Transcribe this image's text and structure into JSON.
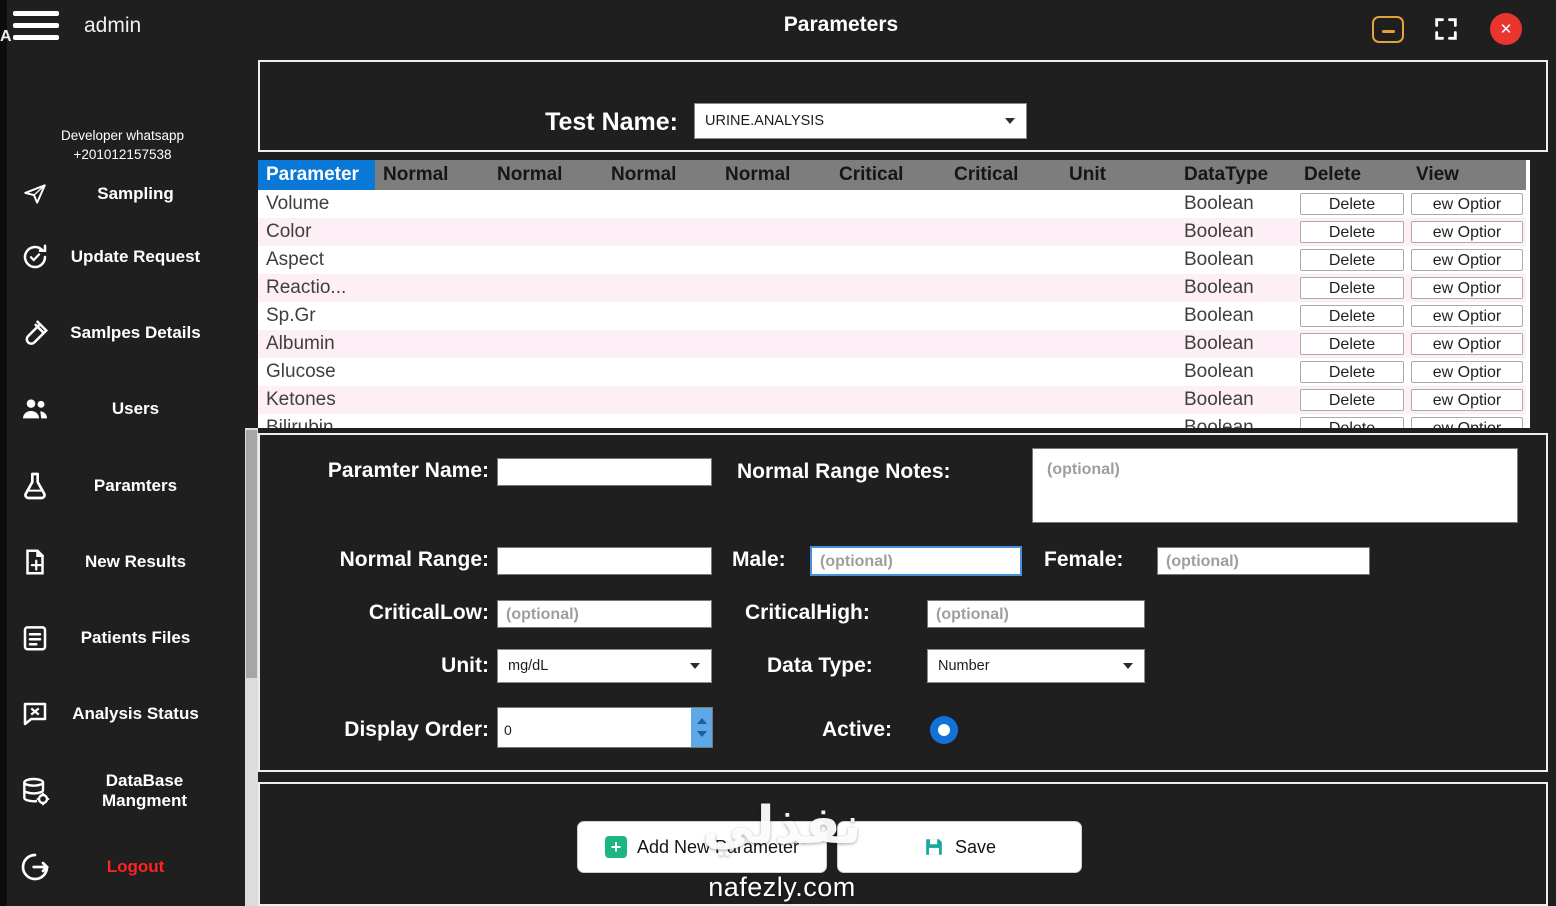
{
  "titlebar": {
    "user": "admin",
    "title": "Parameters"
  },
  "window": {
    "edge_letter": "A"
  },
  "icons": {
    "close": "✕",
    "plus": "+"
  },
  "colors": {
    "background": "#1f1f1f",
    "header_gray": "#7d7d7d",
    "selected_header_blue": "#0a78d7",
    "row_pink": "#fdeff5",
    "close_red": "#e8352e",
    "minimize_orange": "#e3a23c",
    "active_radio_blue": "#1173d8",
    "spinner_blue": "#5fa8e8",
    "add_icon_green": "#1db584",
    "save_icon_teal": "#16a89b",
    "logout_red": "#ff2222"
  },
  "sidebar": {
    "developer_line1": "Developer whatsapp",
    "developer_line2": "+201012157538",
    "items": [
      {
        "label": "Sampling",
        "icon": "paper-plane-icon"
      },
      {
        "label": "Update Request",
        "icon": "refresh-icon"
      },
      {
        "label": "Samlpes Details",
        "icon": "test-tube-icon"
      },
      {
        "label": "Users",
        "icon": "users-icon"
      },
      {
        "label": "Paramters",
        "icon": "flask-icon"
      },
      {
        "label": "New Results",
        "icon": "new-document-icon"
      },
      {
        "label": "Patients Files",
        "icon": "patient-file-icon"
      },
      {
        "label": "Analysis Status",
        "icon": "analysis-chat-icon"
      },
      {
        "label": "DataBase Mangment",
        "icon": "database-gear-icon"
      },
      {
        "label": "Logout",
        "icon": "logout-icon"
      }
    ]
  },
  "test_name": {
    "label": "Test Name:",
    "value": "URINE.ANALYSIS"
  },
  "table": {
    "headers": [
      "Parameter",
      "Normal",
      "Normal",
      "Normal",
      "Normal",
      "Critical",
      "Critical",
      "Unit",
      "DataType",
      "Delete",
      "View"
    ],
    "delete_label": "Delete",
    "view_label": "ew Optior",
    "rows": [
      {
        "parameter": "Volume",
        "datatype": "Boolean"
      },
      {
        "parameter": "Color",
        "datatype": "Boolean"
      },
      {
        "parameter": "Aspect",
        "datatype": "Boolean"
      },
      {
        "parameter": "Reactio...",
        "datatype": "Boolean"
      },
      {
        "parameter": "Sp.Gr",
        "datatype": "Boolean"
      },
      {
        "parameter": "Albumin",
        "datatype": "Boolean"
      },
      {
        "parameter": "Glucose",
        "datatype": "Boolean"
      },
      {
        "parameter": "Ketones",
        "datatype": "Boolean"
      },
      {
        "parameter": "Bilirubin",
        "datatype": "Boolean"
      }
    ]
  },
  "form": {
    "parameter_name_label": "Paramter Name:",
    "normal_range_notes_label": "Normal Range Notes:",
    "normal_range_label": "Normal Range:",
    "male_label": "Male:",
    "female_label": "Female:",
    "critical_low_label": "CriticalLow:",
    "critical_high_label": "CriticalHigh:",
    "unit_label": "Unit:",
    "unit_value": "mg/dL",
    "data_type_label": "Data Type:",
    "data_type_value": "Number",
    "display_order_label": "Display Order:",
    "display_order_value": "0",
    "active_label": "Active:",
    "optional_placeholder": "(optional)"
  },
  "actions": {
    "add_new_label": "Add New Parameter",
    "save_label": "Save"
  },
  "watermark": {
    "logo": "نفذلي",
    "domain": "nafezly.com"
  }
}
